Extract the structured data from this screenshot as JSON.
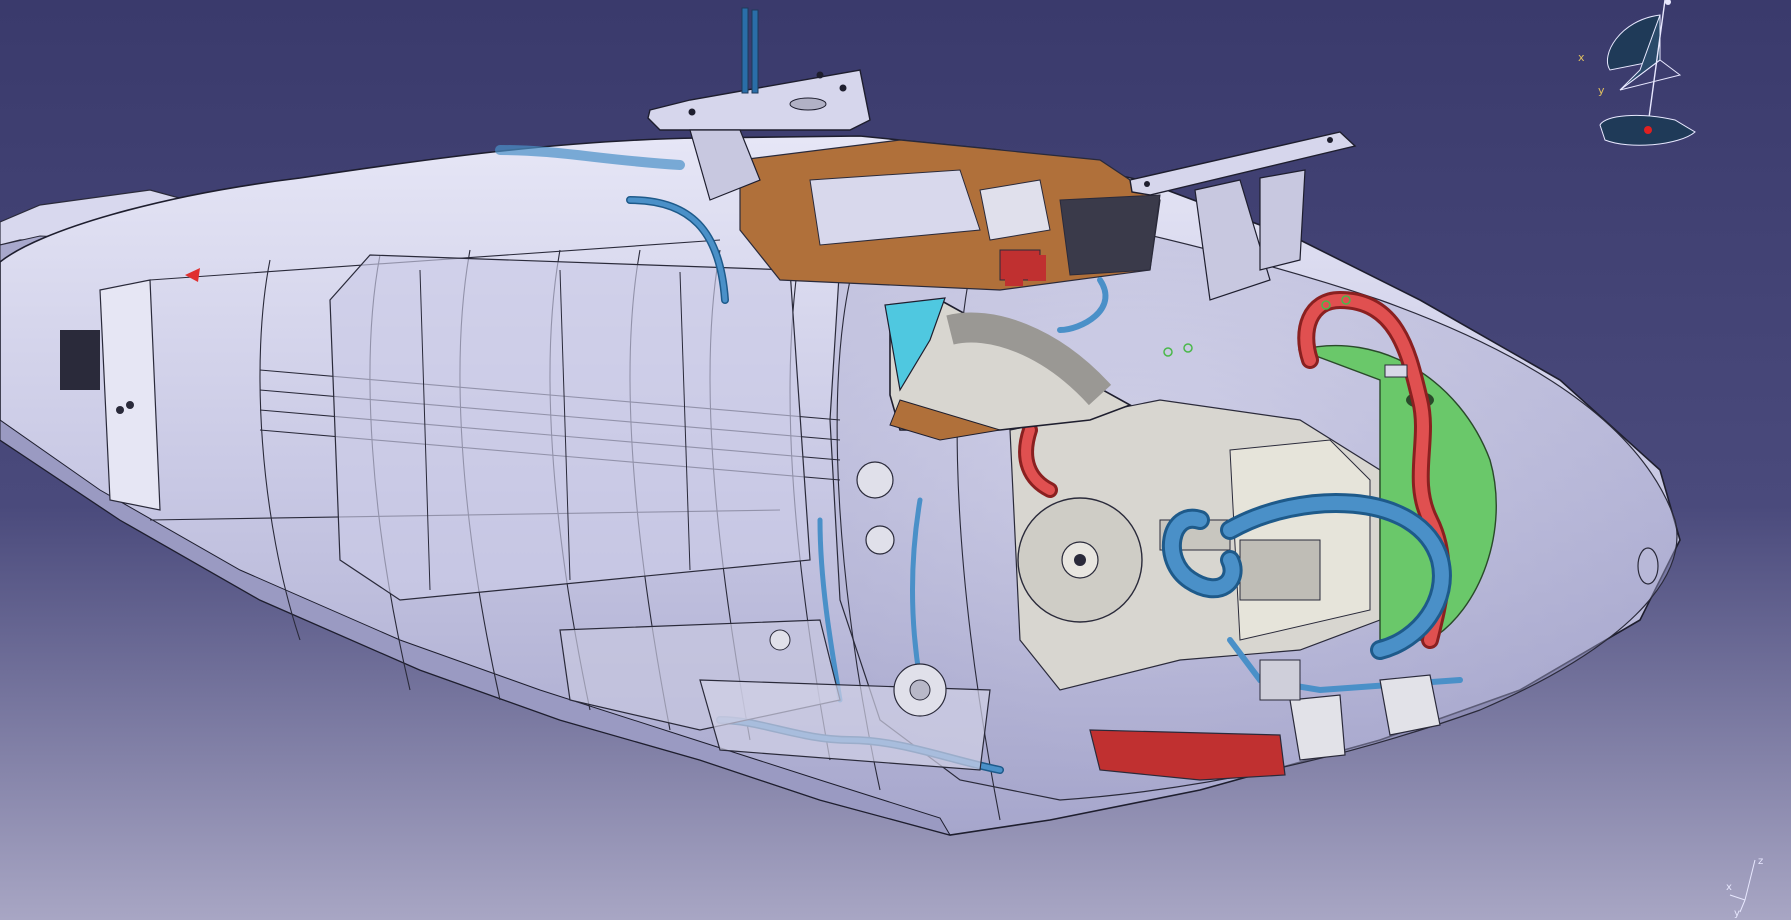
{
  "app": {
    "title": ""
  },
  "viewport": {
    "background_top": "#3a3a6c",
    "background_bottom": "#a8a6c4",
    "model_name": "helicopter-nose-fuselage-assembly"
  },
  "compass": {
    "label_x": "x",
    "label_y": "y",
    "label_z": "z",
    "fill_color": "#1f3a58",
    "outline_color": "#e8e8ff",
    "origin_color": "#e02020"
  },
  "axis_triad": {
    "label_x": "x",
    "label_y": "y",
    "label_z": "z"
  },
  "colors": {
    "shell_fill": "#d4d4ec",
    "shell_stroke": "#2a2a3a",
    "pipe_blue": "#4a90c8",
    "pipe_red": "#e05050",
    "green_part": "#6ac86a",
    "copper_part": "#b0703a",
    "engine_gray": "#d8d6d0",
    "red_component": "#c03030"
  }
}
